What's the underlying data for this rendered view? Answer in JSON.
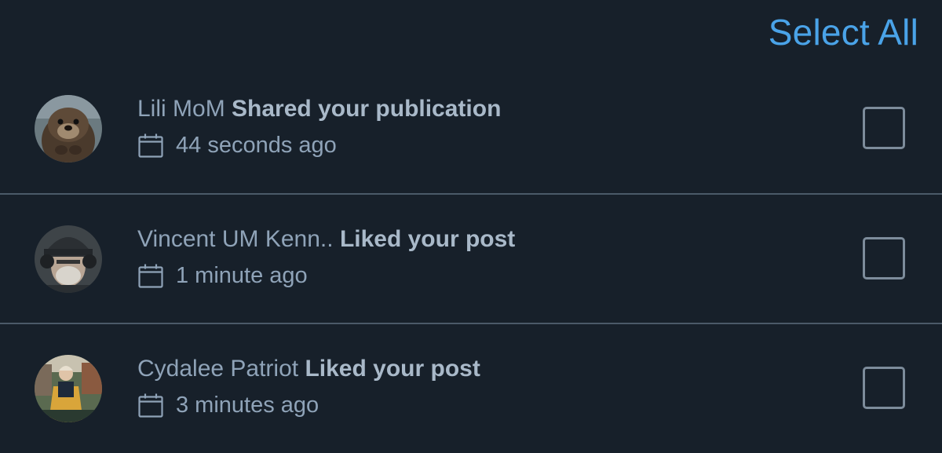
{
  "header": {
    "select_all_label": "Select All"
  },
  "notifications": [
    {
      "user": "Lili MoM",
      "action": "Shared your publication",
      "time": "44 seconds ago",
      "avatar": "otter-photo",
      "checked": false
    },
    {
      "user": "Vincent UM Kenn..",
      "action": "Liked your post",
      "time": "1 minute ago",
      "avatar": "helmeted-man-photo",
      "checked": false
    },
    {
      "user": "Cydalee Patriot",
      "action": "Liked your post",
      "time": "3 minutes ago",
      "avatar": "costumed-woman-photo",
      "checked": false
    }
  ],
  "icons": {
    "time": "calendar-icon"
  },
  "colors": {
    "background": "#17202a",
    "accent": "#4aa3e8",
    "text_muted": "#8fa3b8",
    "divider": "#4b5a68"
  }
}
